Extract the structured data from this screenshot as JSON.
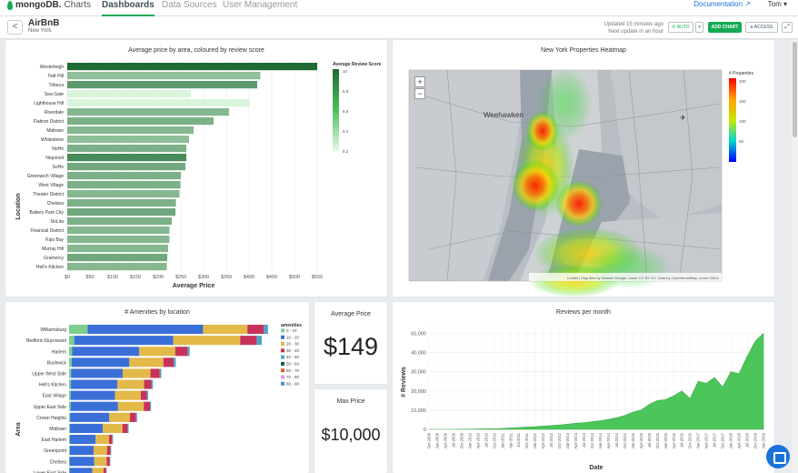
{
  "nav": {
    "brand": "mongoDB.",
    "product": "Charts",
    "tabs": [
      "Dashboards",
      "Data Sources",
      "User Management"
    ],
    "documentation": "Documentation",
    "user": "Tom"
  },
  "header": {
    "back": "<",
    "title": "AirBnB",
    "subtitle": "New York",
    "updated": "Updated 15 minutes ago",
    "next_update": "Next update in an hour",
    "auto": "AUTO",
    "add_chart": "ADD CHART",
    "access": "ACCESS"
  },
  "colors": {
    "brand_green": "#13aa52",
    "link_blue": "#1a73d9"
  },
  "charts": {
    "price_by_area": {
      "title": "Average price by area, coloured by review score",
      "xlabel": "Average Price",
      "ylabel": "Location",
      "legend_title": "Average Review Score",
      "legend_ticks": [
        "10",
        "8.8",
        "8.6",
        "8.4",
        "8.2"
      ],
      "x_ticks": [
        "$0",
        "$50",
        "$100",
        "$150",
        "$200",
        "$250",
        "$300",
        "$350",
        "$400",
        "$450",
        "$500",
        "$550"
      ]
    },
    "heatmap": {
      "title": "New York Properties Heatmap",
      "legend_title": "# Properties",
      "legend_ticks": [
        "200",
        "150",
        "100",
        "50"
      ],
      "place_labels": [
        "Weehawken"
      ],
      "attribution": "Leaflet | Map tiles by Stamen Design, under CC BY 3.0. Data by OpenStreetMap, under ODbL."
    },
    "amenities": {
      "title": "# Amenities by location",
      "ylabel": "Area",
      "legend_title": "amenities",
      "legend_items": [
        {
          "label": "0 - 10",
          "color": "#7dcf8d"
        },
        {
          "label": "10 - 20",
          "color": "#3b6fd8"
        },
        {
          "label": "20 - 30",
          "color": "#e3b94a"
        },
        {
          "label": "30 - 40",
          "color": "#c8325a"
        },
        {
          "label": "40 - 50",
          "color": "#4fa4c7"
        },
        {
          "label": "50 - 60",
          "color": "#1f5e3a"
        },
        {
          "label": "60 - 70",
          "color": "#e0643a"
        },
        {
          "label": "70 - 80",
          "color": "#c8a0d8"
        },
        {
          "label": "80 - 90",
          "color": "#4a90c8"
        }
      ]
    },
    "avg_price": {
      "title": "Average Price",
      "value": "$149"
    },
    "max_price": {
      "title": "Max Price",
      "value": "$10,000"
    },
    "reviews": {
      "title": "Reviews per month",
      "ylabel": "# Reviews",
      "xlabel": "Date",
      "y_ticks": [
        "50,000",
        "40,000",
        "30,000",
        "20,000",
        "10,000",
        "0"
      ]
    }
  },
  "chart_data": [
    {
      "type": "bar",
      "orientation": "horizontal",
      "title": "Average price by area, coloured by review score",
      "xlabel": "Average Price",
      "ylabel": "Location",
      "xlim": [
        0,
        560
      ],
      "categories": [
        "Westerleigh",
        "Todt Hill",
        "Tribeca",
        "Sea Gate",
        "Lighthouse Hill",
        "Riverdale",
        "Flatiron District",
        "Midtown",
        "Whitestone",
        "NoHo",
        "Neponsit",
        "SoHo",
        "Greenwich Village",
        "West Village",
        "Theater District",
        "Chelsea",
        "Battery Park City",
        "NoLita",
        "Financial District",
        "Kips Bay",
        "Murray Hill",
        "Gramercy",
        "Hell's Kitchen"
      ],
      "values": [
        550,
        425,
        418,
        272,
        402,
        356,
        322,
        278,
        268,
        262,
        262,
        260,
        250,
        249,
        247,
        239,
        238,
        230,
        225,
        225,
        222,
        220,
        219
      ],
      "scores": [
        10.0,
        8.9,
        9.4,
        8.2,
        8.2,
        9.0,
        9.1,
        9.0,
        8.9,
        9.1,
        9.6,
        9.2,
        9.1,
        9.1,
        9.0,
        9.1,
        9.2,
        9.1,
        9.0,
        9.0,
        9.0,
        9.2,
        9.0
      ]
    },
    {
      "type": "bar",
      "stacked": true,
      "orientation": "horizontal",
      "title": "# Amenities by location",
      "ylabel": "Area",
      "categories": [
        "Williamsburg",
        "Bedford-Stuyvesant",
        "Harlem",
        "Bushwick",
        "Upper West Side",
        "Hell's Kitchen",
        "East Village",
        "Upper East Side",
        "Crown Heights",
        "Midtown",
        "East Harlem",
        "Greenpoint",
        "Chelsea",
        "Lower East Side"
      ],
      "series": [
        {
          "name": "0 - 10",
          "values": [
            180,
            50,
            30,
            25,
            20,
            18,
            15,
            15,
            10,
            8,
            8,
            8,
            5,
            5
          ]
        },
        {
          "name": "10 - 20",
          "values": [
            1120,
            960,
            650,
            560,
            500,
            450,
            430,
            460,
            380,
            320,
            250,
            230,
            240,
            220
          ]
        },
        {
          "name": "20 - 30",
          "values": [
            430,
            650,
            350,
            330,
            270,
            260,
            250,
            250,
            200,
            190,
            130,
            130,
            120,
            110
          ]
        },
        {
          "name": "30 - 40",
          "values": [
            160,
            160,
            120,
            100,
            90,
            70,
            60,
            60,
            60,
            50,
            30,
            35,
            30,
            25
          ]
        },
        {
          "name": "40 - 50",
          "values": [
            40,
            50,
            20,
            20,
            15,
            15,
            12,
            10,
            10,
            10,
            8,
            5,
            5,
            5
          ]
        }
      ]
    },
    {
      "type": "area",
      "title": "Reviews per month",
      "xlabel": "Date",
      "ylabel": "# Reviews",
      "ylim": [
        0,
        55000
      ],
      "x_labels": [
        "Oct-2008",
        "Jan-2009",
        "Apr-2009",
        "Jul-2009",
        "Oct-2009",
        "Jan-2010",
        "Apr-2010",
        "Jul-2010",
        "Oct-2010",
        "Jan-2011",
        "Apr-2011",
        "Jul-2011",
        "Oct-2011",
        "Jan-2012",
        "Apr-2012",
        "Jul-2012",
        "Oct-2012",
        "Jan-2013",
        "Apr-2013",
        "Jul-2013",
        "Oct-2013",
        "Jan-2014",
        "Apr-2014",
        "Jul-2014",
        "Oct-2014",
        "Jan-2015",
        "Apr-2015",
        "Jul-2015",
        "Oct-2015",
        "Jan-2016",
        "Apr-2016",
        "Jul-2016",
        "Oct-2016",
        "Jan-2017",
        "Apr-2017",
        "Jul-2017",
        "Oct-2017",
        "Jan-2018",
        "Apr-2018",
        "Jul-2018",
        "Oct-2018",
        "Jan-2019"
      ],
      "x": [
        0,
        1,
        2,
        3,
        4,
        5,
        6,
        7,
        8,
        9,
        10,
        11,
        12,
        13,
        14,
        15,
        16,
        17,
        18,
        19,
        20,
        21,
        22,
        23,
        24,
        25,
        26,
        27,
        28,
        29,
        30,
        31,
        32,
        33,
        34,
        35,
        36,
        37,
        38,
        39,
        40,
        41
      ],
      "values": [
        0,
        0,
        0,
        0,
        100,
        100,
        200,
        300,
        300,
        500,
        700,
        900,
        1200,
        1400,
        1700,
        2000,
        2300,
        2700,
        3200,
        3500,
        4000,
        4500,
        5200,
        6000,
        7200,
        9000,
        10000,
        13000,
        15000,
        15500,
        17500,
        20000,
        16000,
        25000,
        24000,
        27000,
        22000,
        30000,
        29000,
        38000,
        46000,
        50000
      ]
    }
  ]
}
